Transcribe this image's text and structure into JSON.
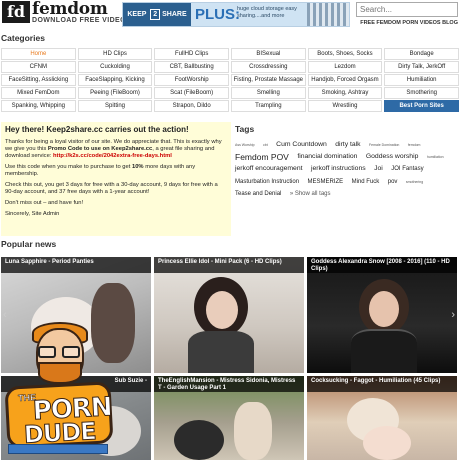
{
  "header": {
    "logo_fd": "fd",
    "logo_name": "femdom",
    "logo_tag": "DOWNLOAD FREE VIDEO",
    "banner_k2s_left": "KEEP",
    "banner_k2s_box": "2",
    "banner_k2s_right": "SHARE",
    "banner_plus": "PLUS:",
    "banner_desc": "huge cloud storage easy sharing....and more",
    "search_placeholder": "Search...",
    "tagline": "FREE FEMDOM PORN VIDEOS BLOG"
  },
  "categories": {
    "title": "Categories",
    "items": [
      "Home",
      "HD Clips",
      "FullHD Clips",
      "BISexual",
      "Boots, Shoes, Socks",
      "Bondage",
      "CFNM",
      "Cuckolding",
      "CBT, Ballbusting",
      "Crossdressing",
      "Lezdom",
      "Dirty Talk, JerkOff",
      "FaceSitting, Asslicking",
      "FaceSlapping, Kicking",
      "FootWorship",
      "Fisting, Prostate Massage",
      "Handjob, Forced Orgasm",
      "Humiliation",
      "Mixed FemDom",
      "Peeing (FileBoom)",
      "Scat (FileBoom)",
      "Smelling",
      "Smoking, Ashtray",
      "Smothering",
      "Spanking, Whipping",
      "Spitting",
      "Strapon, Dildo",
      "Trampling",
      "Wrestling",
      "Best Porn Sites"
    ]
  },
  "notice": {
    "heading": "Hey there! Keep2share.cc carries out the action!",
    "p1_a": "Thanks for being a loyal visitor of our site. We do appreciate that. This is exactly why we give you this ",
    "p1_bold": "Promo Code to use on Keep2share.cc",
    "p1_b": ", a great file sharing and download service: ",
    "p1_link": "http://k2s.cc/code/2042extra-free-days.html",
    "p2_a": "Use this code when you make to purchase to get ",
    "p2_bold": "10%",
    "p2_b": " more days with any membership.",
    "p3": "Check this out, you get 3 days for free with a 30-day account, 9 days for free with a 90-day account, and 37 free days with a 1-year account!",
    "p4": "Don't miss out – and have fun!",
    "p5": "Sincerely, Site Admin"
  },
  "tags": {
    "title": "Tags",
    "items": [
      {
        "label": "Ass Worship",
        "size": 1
      },
      {
        "label": "cbt",
        "size": 1
      },
      {
        "label": "Cum Countdown",
        "size": 3
      },
      {
        "label": "dirty talk",
        "size": 3
      },
      {
        "label": "Female Domination",
        "size": 1
      },
      {
        "label": "femdom",
        "size": 1
      },
      {
        "label": "Femdom POV",
        "size": 4
      },
      {
        "label": "financial domination",
        "size": 3
      },
      {
        "label": "Goddess worship",
        "size": 3
      },
      {
        "label": "humiliation",
        "size": 1
      },
      {
        "label": "jerkoff encouragement",
        "size": 3
      },
      {
        "label": "jerkoff instructions",
        "size": 3
      },
      {
        "label": "Joi",
        "size": 3
      },
      {
        "label": "JOI Fantasy",
        "size": 2
      },
      {
        "label": "Masturbation Instruction",
        "size": 2
      },
      {
        "label": "MESMERIZE",
        "size": 2
      },
      {
        "label": "Mind Fuck",
        "size": 2
      },
      {
        "label": "pov",
        "size": 2
      },
      {
        "label": "smothering",
        "size": 1
      },
      {
        "label": "Tease and Denial",
        "size": 2
      },
      {
        "label": "» Show all tags",
        "size": 2
      }
    ]
  },
  "popular": {
    "title": "Popular news",
    "cards": [
      {
        "title": "Luna Sapphire - Period Panties"
      },
      {
        "title": "Princess Ellie Idol - Mini Pack (6 - HD Clips)"
      },
      {
        "title": "Goddess Alexandra Snow [2008 - 2016] (110 - HD Clips)"
      },
      {
        "title": "Sub Suzie -"
      },
      {
        "title": "TheEnglishMansion - Mistress Sidonia, Mistress T - Garden Usage Part 1"
      },
      {
        "title": "Cocksucking - Faggot - Humiliation (45 Clips)"
      }
    ]
  },
  "badge": {
    "the": "THE",
    "porn": "PORN",
    "dude": "DUDE"
  },
  "colors": {
    "accent_orange": "#e87a1d",
    "highlight_blue": "#2e6aa6",
    "notice_bg": "#fffdd8",
    "link_red": "#cc0000"
  }
}
